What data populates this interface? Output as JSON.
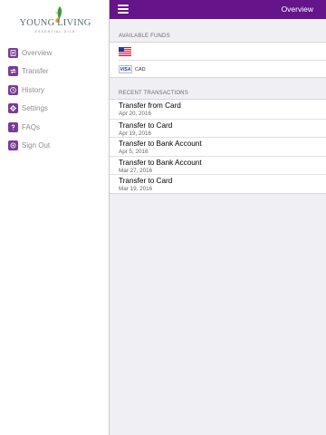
{
  "brand": {
    "logo_text": "YOUNG LIVING",
    "logo_sub": "ESSENTIAL OILS"
  },
  "sidebar": {
    "items": [
      {
        "label": "Overview",
        "icon": "document-icon"
      },
      {
        "label": "Transfer",
        "icon": "transfer-icon"
      },
      {
        "label": "History",
        "icon": "history-icon"
      },
      {
        "label": "Settings",
        "icon": "settings-icon"
      },
      {
        "label": "FAQs",
        "icon": "question-icon"
      },
      {
        "label": "Sign Out",
        "icon": "sign-out-icon"
      }
    ]
  },
  "header": {
    "title": "Overview"
  },
  "funds": {
    "section_label": "AVAILABLE FUNDS",
    "rows": [
      {
        "icon": "us-flag-icon",
        "currency": ""
      },
      {
        "icon": "visa-card-icon",
        "card_brand": "VISA",
        "currency": "CAD"
      }
    ]
  },
  "transactions": {
    "section_label": "RECENT TRANSACTIONS",
    "rows": [
      {
        "title": "Transfer from Card",
        "date": "Apr 20, 2016"
      },
      {
        "title": "Transfer to Card",
        "date": "Apr 19, 2016"
      },
      {
        "title": "Transfer to Bank Account",
        "date": "Apr 5, 2016"
      },
      {
        "title": "Transfer to Bank Account",
        "date": "Mar 27, 2016"
      },
      {
        "title": "Transfer to Card",
        "date": "Mar 19, 2016"
      }
    ]
  },
  "colors": {
    "accent": "#65148a",
    "icon_purple": "#7a3b96",
    "background": "#efeff4"
  }
}
